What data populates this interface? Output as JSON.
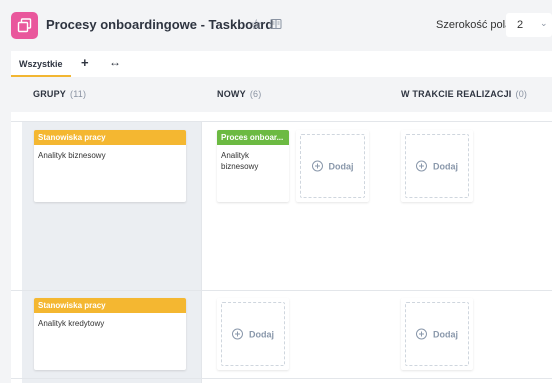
{
  "header": {
    "title": "Procesy onboardingowe - Taskboard",
    "width_label": "Szerokość pola",
    "width_value": "2",
    "app_color": "#e9579c"
  },
  "tabs": {
    "all_label": "Wszystkie",
    "add_label": "+",
    "expand_label": "↔",
    "active_color": "#f2b632"
  },
  "columns": [
    {
      "name": "GRUPY",
      "count": "(11)"
    },
    {
      "name": "NOWY",
      "count": "(6)"
    },
    {
      "name": "W TRAKCIE REALIZACJI",
      "count": "(0)"
    }
  ],
  "rows": [
    {
      "group": {
        "tag": "Stanowiska pracy",
        "text": "Analityk biznesowy"
      },
      "new_card": {
        "tag": "Proces onboar...",
        "text": "Analityk biznesowy"
      },
      "add_label": "Dodaj"
    },
    {
      "group": {
        "tag": "Stanowiska pracy",
        "text": "Analityk kredytowy"
      },
      "add_label": "Dodaj"
    }
  ],
  "colors": {
    "tag_yellow": "#f4b731",
    "tag_green": "#6cba42"
  }
}
